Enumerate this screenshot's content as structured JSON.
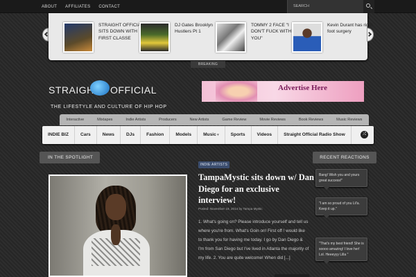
{
  "topnav": {
    "items": [
      "ABOUT",
      "AFFILIATES",
      "CONTACT"
    ]
  },
  "search": {
    "placeholder": "SEARCH"
  },
  "slider": {
    "slides": [
      {
        "title": "STRAIGHT OFFICIAL SITS DOWN WITH FIRST CLASSE"
      },
      {
        "title": "DJ Gates Brooklyn Hustlers Pt 1"
      },
      {
        "title": "TOMMY 2 FACE \"I DON'T FUCK WITH YOU\""
      },
      {
        "title": "Kevin Durant has right foot surgery"
      }
    ],
    "breaking_label": "BREAKING"
  },
  "site": {
    "logo_part1": "STRAIGHT",
    "logo_part2": "OFFICIAL",
    "tagline": "THE LIFESTYLE AND CULTURE OF HIP HOP",
    "ad_text": "Advertise Here"
  },
  "category_bar": [
    "Interactive",
    "Mixtapes",
    "Indie Artists",
    "Producers",
    "New Artists",
    "Game Review",
    "Movie Reviews",
    "Book Reviews",
    "Music Reviews"
  ],
  "main_nav": [
    "INDIE BIZ",
    "Cars",
    "News",
    "DJs",
    "Fashion",
    "Models",
    "Music",
    "Sports",
    "Videos",
    "Straight Official Radio Show"
  ],
  "spotlight": {
    "heading": "IN THE SPOTLIGHT",
    "category": "INDIE ARTISTS",
    "title": "TampaMystic sits down w/ Dan Diego for an exclusive interview!",
    "meta": "Posted: November 19, 2014  by  Tampa Mystic",
    "excerpt": "1. What's going on? Please introduce yourself and tell us where you're from. What's Goin on! First off ! would like to thank you for having me today. I go by Dan Diego & I'm from San Diego but I've lived in Atlanta the majority of my life. 2. You are quite welcome! When did [...]"
  },
  "recent_reactions": {
    "heading": "RECENT REACTIONS",
    "comments": [
      "Bang! Wish you and yours great success!\"",
      "\"I am so proud of you Lil'a. Keep it up.\"",
      "\"That's my best friend! She is soooo amazing! I love her! Lol. Heeeyyy Lilla \""
    ]
  },
  "colors": {
    "accent": "#3b4d6e",
    "background": "#2b2b2b",
    "nav_bg": "#f0f0f0"
  }
}
